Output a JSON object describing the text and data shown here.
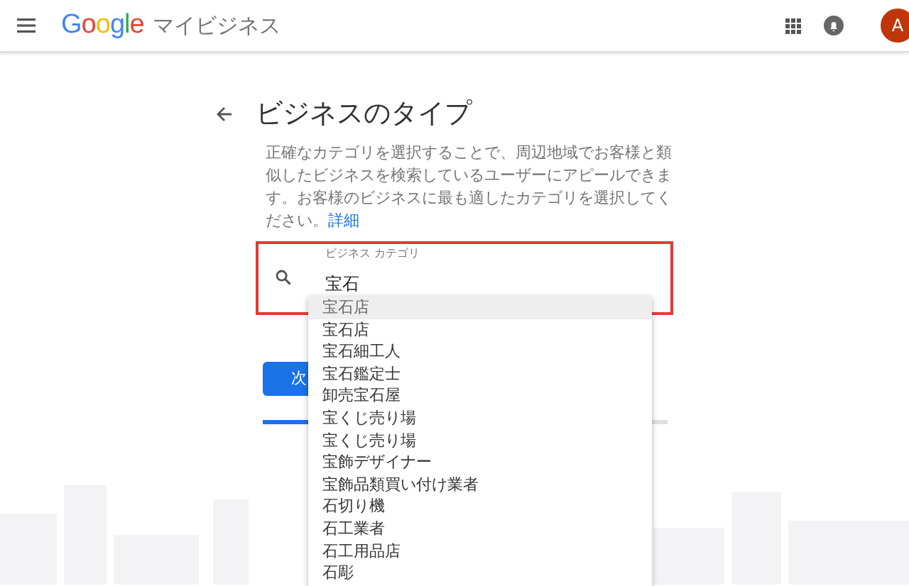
{
  "header": {
    "logo": "Google",
    "product": "マイビジネス",
    "avatar": "A"
  },
  "page": {
    "title": "ビジネスのタイプ",
    "description": "正確なカテゴリを選択することで、周辺地域でお客様と類似したビジネスを検索しているユーザーにアピールできます。お客様のビジネスに最も適したカテゴリを選択してください。",
    "link": "詳細"
  },
  "field": {
    "label": "ビジネス カテゴリ",
    "value": "宝石",
    "highlighted": true
  },
  "suggestions": [
    {
      "text": "宝石店",
      "selected": true
    },
    {
      "text": "宝石店",
      "selected": false
    },
    {
      "text": "宝石細工人",
      "selected": false
    },
    {
      "text": "宝石鑑定士",
      "selected": false
    },
    {
      "text": "卸売宝石屋",
      "selected": false
    },
    {
      "text": "宝くじ売り場",
      "selected": false
    },
    {
      "text": "宝くじ売り場",
      "selected": false
    },
    {
      "text": "宝飾デザイナー",
      "selected": false
    },
    {
      "text": "宝飾品類買い付け業者",
      "selected": false
    },
    {
      "text": "石切り機",
      "selected": false
    },
    {
      "text": "石工業者",
      "selected": false
    },
    {
      "text": "石工用品店",
      "selected": false
    },
    {
      "text": "石彫",
      "selected": false
    }
  ],
  "next_button": "次",
  "progress": {
    "level": 0.12
  }
}
